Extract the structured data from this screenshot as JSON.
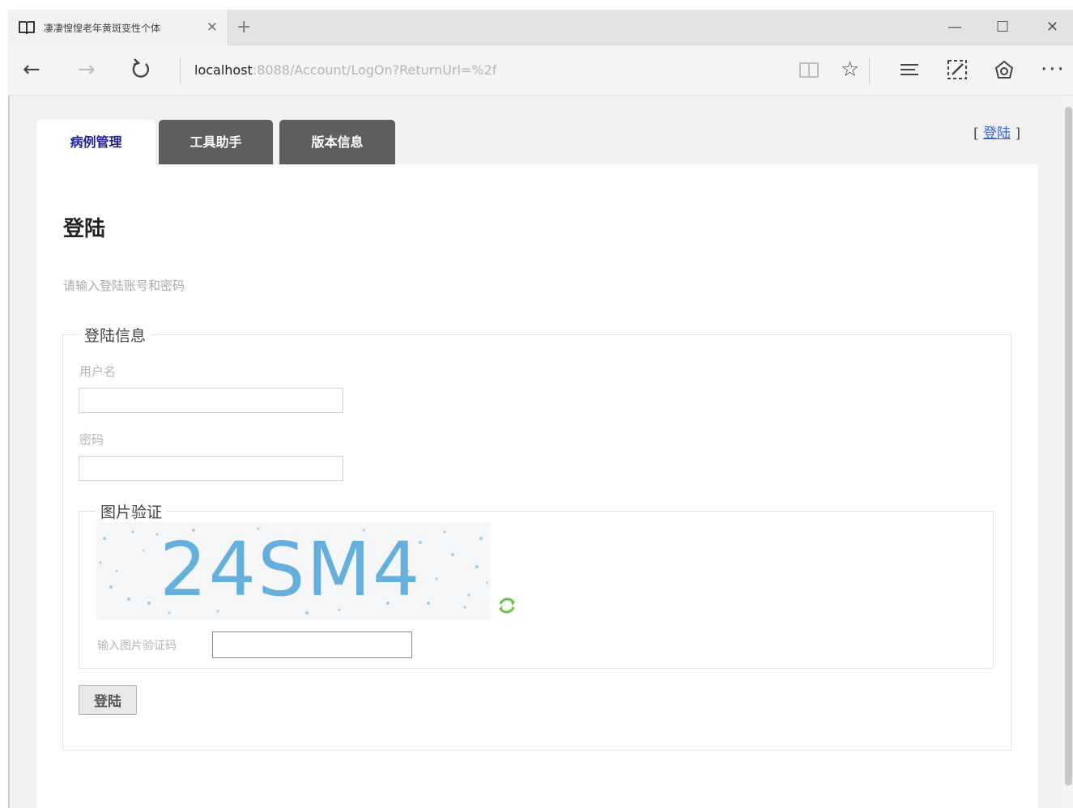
{
  "browser": {
    "tab_title": "凄凄惶惶老年黄斑变性个体",
    "tab_close": "✕",
    "new_tab": "+",
    "address_host": "localhost",
    "address_path": ":8088/Account/LogOn?ReturnUrl=%2f",
    "icons": [
      "book-icon",
      "back-icon",
      "forward-icon",
      "refresh-icon",
      "reading-view-icon",
      "favorite-star-icon",
      "hub-icon",
      "web-note-icon",
      "share-icon",
      "more-icon"
    ]
  },
  "site_nav": {
    "tabs": [
      {
        "label": "病例管理",
        "active": true
      },
      {
        "label": "工具助手",
        "active": false
      },
      {
        "label": "版本信息",
        "active": false
      }
    ],
    "login_link_prefix": "[",
    "login_link": "登陆",
    "login_link_suffix": "]"
  },
  "page": {
    "title": "登陆",
    "description": "请输入登陆账号和密码"
  },
  "login_form": {
    "legend": "登陆信息",
    "username_label": "用户名",
    "username_value": "",
    "password_label": "密码",
    "password_value": "",
    "captcha": {
      "legend": "图片验证",
      "code": "24SM4",
      "input_label": "输入图片验证码",
      "input_value": ""
    },
    "submit_label": "登陆"
  },
  "colors": {
    "tab_active_text": "#1f1f9a",
    "tab_inactive_bg": "#5e5e5e",
    "captcha_text": "#4da3d8",
    "refresh_green": "#6cc24a",
    "link_blue": "#3a63c9"
  }
}
